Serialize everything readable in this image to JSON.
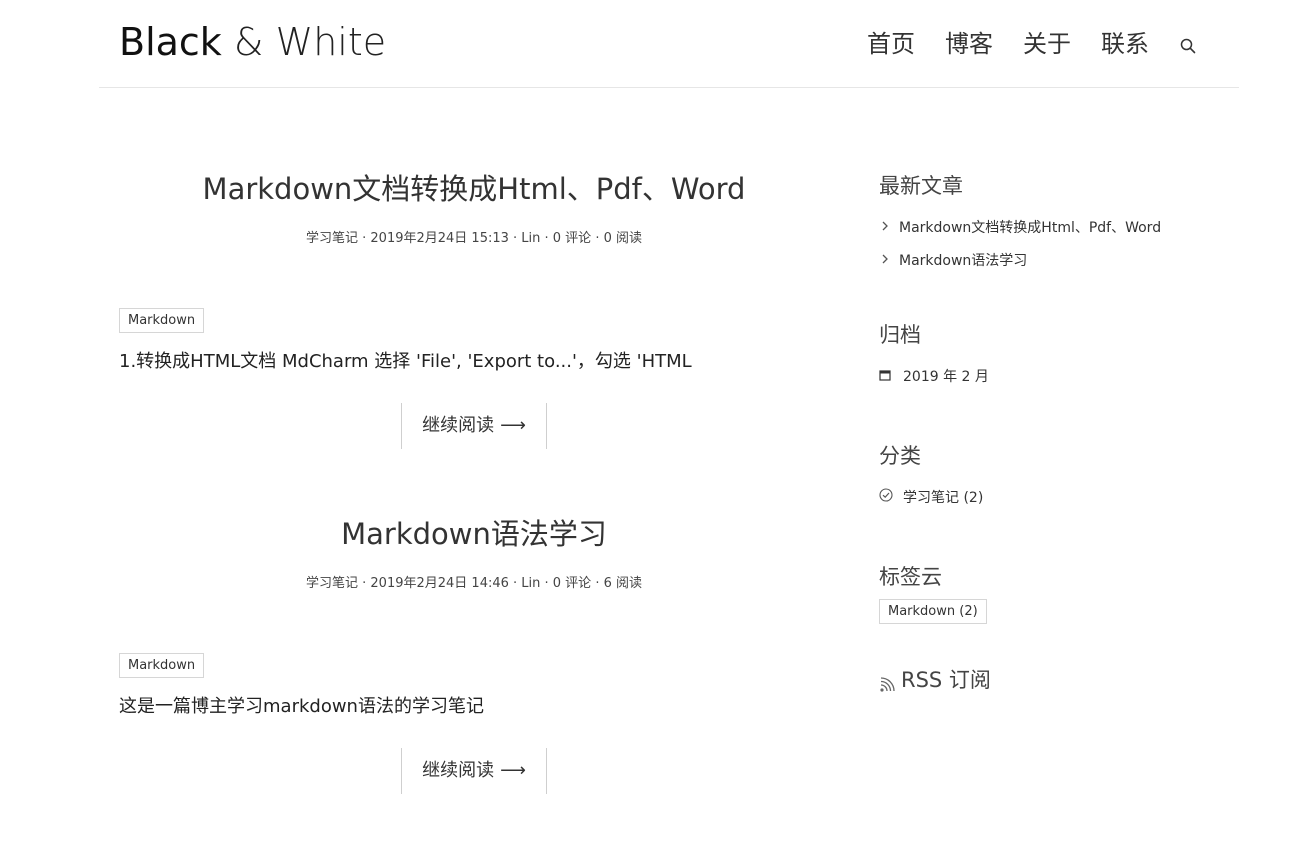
{
  "header": {
    "brand_part1": "Black",
    "brand_amp": "&",
    "brand_part2": "White",
    "nav": [
      "首页",
      "博客",
      "关于",
      "联系"
    ]
  },
  "posts": [
    {
      "title": "Markdown文档转换成Html、Pdf、Word",
      "meta": "学习笔记 · 2019年2月24日 15:13 · Lin · 0 评论 · 0 阅读",
      "tag": "Markdown",
      "excerpt": "1.转换成HTML文档 MdCharm 选择 'File', 'Export to...'，勾选 'HTML",
      "read_more": "继续阅读"
    },
    {
      "title": "Markdown语法学习",
      "meta": "学习笔记 · 2019年2月24日 14:46 · Lin · 0 评论 · 6 阅读",
      "tag": "Markdown",
      "excerpt": "这是一篇博主学习markdown语法的学习笔记",
      "read_more": "继续阅读"
    }
  ],
  "sidebar": {
    "recent_title": "最新文章",
    "recent": [
      "Markdown文档转换成Html、Pdf、Word",
      "Markdown语法学习"
    ],
    "archive_title": "归档",
    "archive": [
      "2019 年 2 月"
    ],
    "category_title": "分类",
    "categories": [
      "学习笔记 (2)"
    ],
    "tags_title": "标签云",
    "tags": [
      "Markdown (2)"
    ],
    "rss": "RSS 订阅"
  },
  "icons": {
    "search": "search-icon",
    "chevron": "chevron-right-icon",
    "calendar": "calendar-icon",
    "category": "check-circle-icon",
    "rss": "rss-icon",
    "arrow": "arrow-right-icon"
  }
}
